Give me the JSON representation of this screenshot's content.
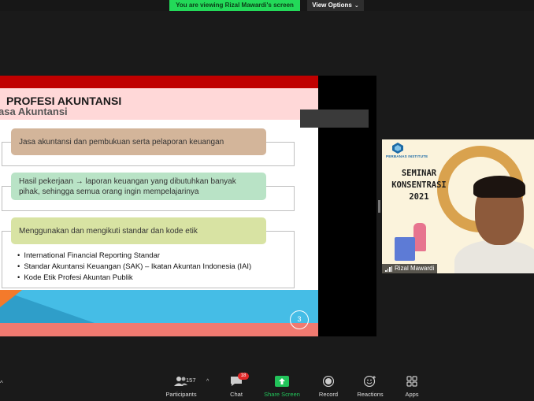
{
  "top_bar": {
    "viewing_banner": "You are viewing Rizal Mawardi's screen",
    "view_options_label": "View Options",
    "banner_color": "#23d959"
  },
  "slide": {
    "title": "PROFESI AKUNTANSI",
    "subtitle": "asa Akuntansi",
    "points": [
      {
        "text": "Jasa akuntansi dan pembukuan serta pelaporan keuangan",
        "color": "#d3b59a"
      },
      {
        "text": "Hasil pekerjaan → laporan keuangan yang dibutuhkan banyak pihak, sehingga semua orang ingin mempelajarinya",
        "color": "#b9e3c6"
      },
      {
        "text": "Menggunakan dan mengikuti  standar dan kode etik",
        "color": "#d8e3a3"
      }
    ],
    "bullets": [
      "International Financial Reporting Standar",
      "Standar Akuntansi Keuangan (SAK) – Ikatan Akuntan Indonesia (IAI)",
      "Kode Etik Profesi Akuntan Publik"
    ],
    "page_number": "3"
  },
  "video_tile": {
    "logo_text": "PERBANAS INSTITUTE",
    "poster_lines": [
      "SEMINAR",
      "KONSENTRASI",
      "2021"
    ],
    "participant_name": "Rizal Mawardi"
  },
  "toolbar": {
    "participants": {
      "label": "Participants",
      "count": "157",
      "icon": "participants-icon"
    },
    "chat": {
      "label": "Chat",
      "badge": "18",
      "icon": "chat-icon"
    },
    "share_screen": {
      "label": "Share Screen",
      "icon": "share-screen-icon",
      "color": "#22c35a"
    },
    "record": {
      "label": "Record",
      "icon": "record-icon"
    },
    "reactions": {
      "label": "Reactions",
      "icon": "reactions-icon"
    },
    "apps": {
      "label": "Apps",
      "icon": "apps-icon"
    }
  }
}
